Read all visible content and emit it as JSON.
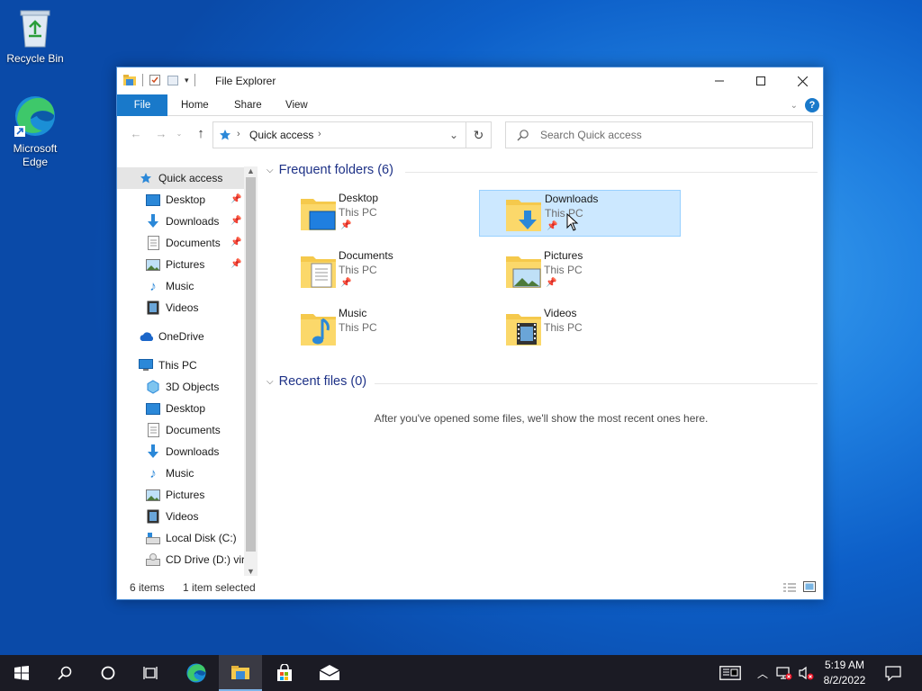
{
  "desktop": {
    "icons": [
      {
        "label": "Recycle Bin",
        "icon": "recycle-bin-icon"
      },
      {
        "label": "Microsoft Edge",
        "icon": "edge-icon"
      }
    ]
  },
  "window": {
    "title": "File Explorer",
    "ribbon": {
      "tabs": [
        "File",
        "Home",
        "Share",
        "View"
      ],
      "help": "?"
    },
    "address": {
      "crumb": "Quick access"
    },
    "search": {
      "placeholder": "Search Quick access"
    },
    "nav": {
      "quick_access": "Quick access",
      "pinned": [
        "Desktop",
        "Downloads",
        "Documents",
        "Pictures"
      ],
      "recent": [
        "Music",
        "Videos"
      ],
      "onedrive": "OneDrive",
      "this_pc": "This PC",
      "pc_items": [
        "3D Objects",
        "Desktop",
        "Documents",
        "Downloads",
        "Music",
        "Pictures",
        "Videos",
        "Local Disk (C:)",
        "CD Drive (D:) virt"
      ]
    },
    "content": {
      "frequent_header": "Frequent folders (6)",
      "recent_header": "Recent files (0)",
      "empty_message": "After you've opened some files, we'll show the most recent ones here.",
      "folders": [
        {
          "name": "Desktop",
          "location": "This PC",
          "pinned": true,
          "selected": false
        },
        {
          "name": "Downloads",
          "location": "This PC",
          "pinned": true,
          "selected": true
        },
        {
          "name": "Documents",
          "location": "This PC",
          "pinned": true,
          "selected": false
        },
        {
          "name": "Pictures",
          "location": "This PC",
          "pinned": true,
          "selected": false
        },
        {
          "name": "Music",
          "location": "This PC",
          "pinned": false,
          "selected": false
        },
        {
          "name": "Videos",
          "location": "This PC",
          "pinned": false,
          "selected": false
        }
      ]
    },
    "status": {
      "items": "6 items",
      "selected": "1 item selected"
    }
  },
  "taskbar": {
    "time": "5:19 AM",
    "date": "8/2/2022",
    "apps": [
      "start-icon",
      "search-icon",
      "cortana-icon",
      "task-view-icon",
      "edge-icon",
      "file-explorer-icon",
      "store-icon",
      "mail-icon"
    ]
  },
  "colors": {
    "accent": "#1979ca",
    "selection": "#cce8ff",
    "header": "#1e3287"
  }
}
